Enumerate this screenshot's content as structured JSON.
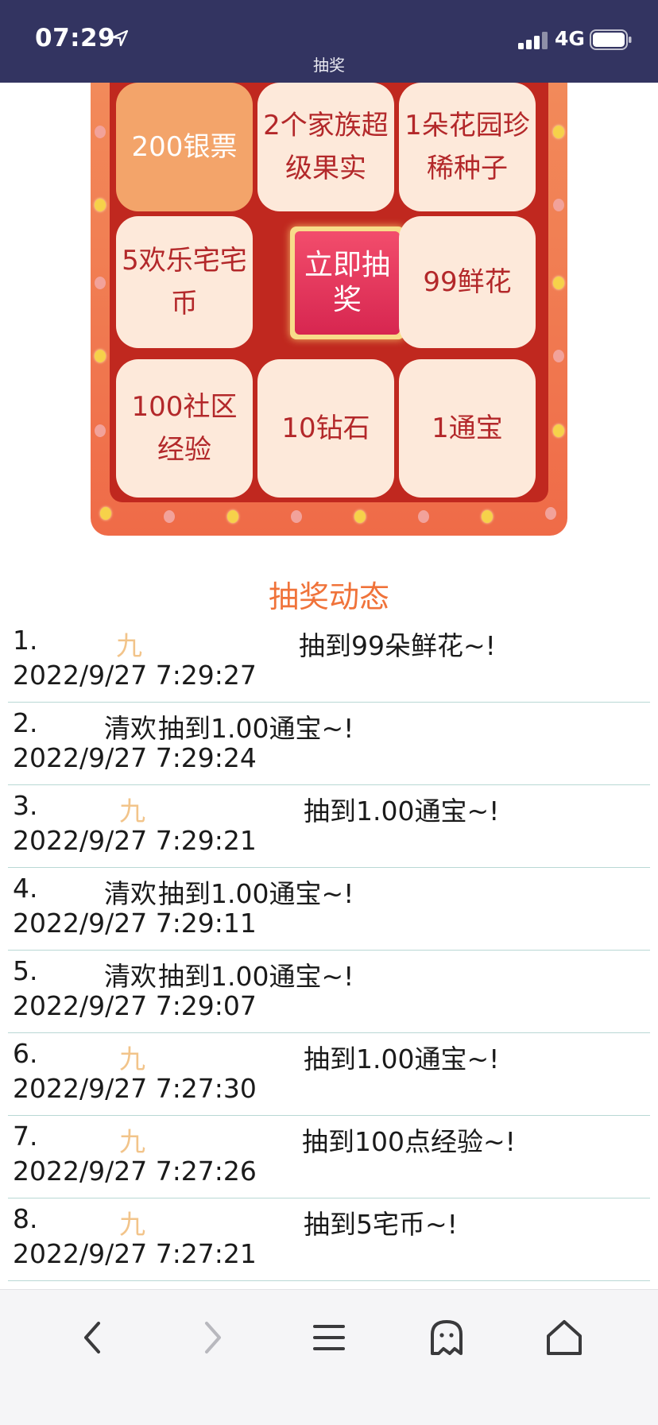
{
  "status_bar": {
    "time": "07:29",
    "network": "4G"
  },
  "page": {
    "title": "抽奖"
  },
  "board": {
    "cells": [
      {
        "label": "200银票",
        "active": true
      },
      {
        "label": "2个家族超级果实"
      },
      {
        "label": "1朵花园珍稀种子"
      },
      {
        "label": "5欢乐宅宅币"
      },
      {
        "label": "99鲜花"
      },
      {
        "label": "100社区经验"
      },
      {
        "label": "10钻石"
      },
      {
        "label": "1通宝"
      }
    ],
    "draw_button": "立即抽奖"
  },
  "feed": {
    "title": "抽奖动态",
    "items": [
      {
        "index": "1.",
        "user": "九",
        "prize": "抽到99朵鲜花~!",
        "time": "2022/9/27 7:29:27"
      },
      {
        "index": "2.",
        "user": "清欢",
        "prize": "抽到1.00通宝~!",
        "time": "2022/9/27 7:29:24"
      },
      {
        "index": "3.",
        "user": "九",
        "prize": "抽到1.00通宝~!",
        "time": "2022/9/27 7:29:21"
      },
      {
        "index": "4.",
        "user": "清欢",
        "prize": "抽到1.00通宝~!",
        "time": "2022/9/27 7:29:11"
      },
      {
        "index": "5.",
        "user": "清欢",
        "prize": "抽到1.00通宝~!",
        "time": "2022/9/27 7:29:07"
      },
      {
        "index": "6.",
        "user": "九",
        "prize": "抽到1.00通宝~!",
        "time": "2022/9/27 7:27:30"
      },
      {
        "index": "7.",
        "user": "九",
        "prize": "抽到100点经验~!",
        "time": "2022/9/27 7:27:26"
      },
      {
        "index": "8.",
        "user": "九",
        "prize": "抽到5宅币~!",
        "time": "2022/9/27 7:27:21"
      }
    ]
  },
  "toolbar": {
    "icons": [
      "back-icon",
      "forward-icon",
      "menu-icon",
      "ghost-icon",
      "home-icon"
    ]
  },
  "colors": {
    "header_bg": "#333461",
    "board_outer": "#ef6b48",
    "board_inner": "#c0281f",
    "cell_bg": "#fde9da",
    "cell_text": "#b3282a",
    "feed_title": "#f0733a"
  }
}
